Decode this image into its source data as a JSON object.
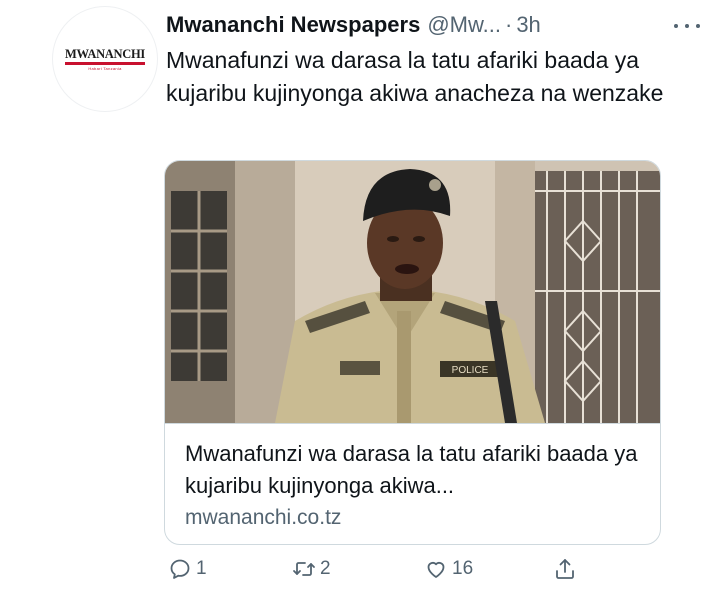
{
  "author": {
    "name": "Mwananchi Newspapers",
    "handle": "@Mw...",
    "separator": "·",
    "time": "3h",
    "avatar_text": "MWANANCHI",
    "avatar_subtext": "Habari Tanzania"
  },
  "tweet": {
    "text": "Mwanafunzi wa darasa la tatu afariki baada ya kujaribu kujinyonga akiwa anacheza na wenzake"
  },
  "card": {
    "image_alt": "Photo of a police officer in uniform speaking in front of a building",
    "title": "Mwanafunzi wa darasa la tatu afariki baada ya kujaribu kujinyonga akiwa...",
    "domain": "mwananchi.co.tz",
    "uniform_badge": "POLICE"
  },
  "actions": {
    "reply_count": "1",
    "retweet_count": "2",
    "like_count": "16",
    "share_icon": "share-icon"
  },
  "colors": {
    "text": "#0f1419",
    "secondary": "#536471",
    "border": "#cfd9de",
    "brand_red": "#c8102e"
  }
}
